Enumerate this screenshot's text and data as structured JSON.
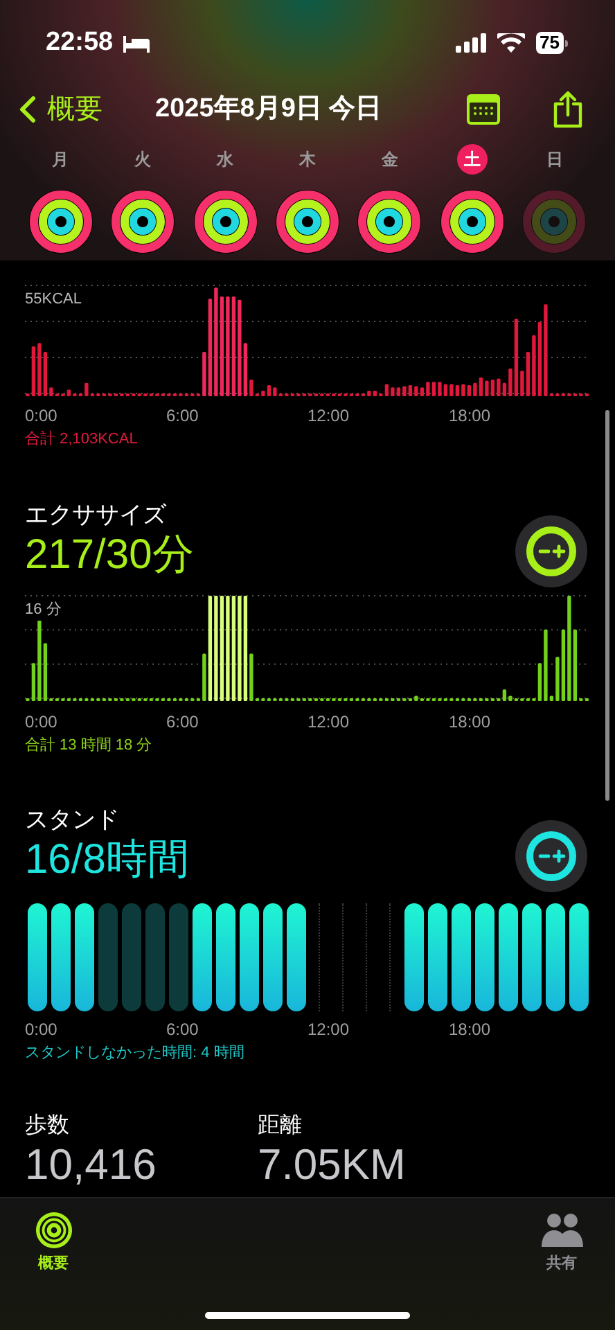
{
  "status_bar": {
    "time": "22:58",
    "battery": "75"
  },
  "nav": {
    "back": "概要",
    "title": "2025年8月9日 今日"
  },
  "week": [
    {
      "day": "月",
      "selected": false,
      "future": false
    },
    {
      "day": "火",
      "selected": false,
      "future": false
    },
    {
      "day": "水",
      "selected": false,
      "future": false
    },
    {
      "day": "木",
      "selected": false,
      "future": false
    },
    {
      "day": "金",
      "selected": false,
      "future": false
    },
    {
      "day": "土",
      "selected": true,
      "future": false
    },
    {
      "day": "日",
      "selected": false,
      "future": true
    }
  ],
  "move": {
    "y_label": "55KCAL",
    "x_labels": [
      "0:00",
      "6:00",
      "12:00",
      "18:00"
    ],
    "total": "合計 2,103KCAL"
  },
  "exercise": {
    "title": "エクササイズ",
    "value": "217/30分",
    "y_label": "16 分",
    "x_labels": [
      "0:00",
      "6:00",
      "12:00",
      "18:00"
    ],
    "total": "合計 13 時間 18 分"
  },
  "stand": {
    "title": "スタンド",
    "value": "16/8時間",
    "x_labels": [
      "0:00",
      "6:00",
      "12:00",
      "18:00"
    ],
    "note": "スタンドしなかった時間: 4 時間",
    "hours": [
      {
        "kind": "stood"
      },
      {
        "kind": "stood"
      },
      {
        "kind": "stood"
      },
      {
        "kind": "missed"
      },
      {
        "kind": "missed"
      },
      {
        "kind": "missed"
      },
      {
        "kind": "missed"
      },
      {
        "kind": "stood"
      },
      {
        "kind": "stood"
      },
      {
        "kind": "stood"
      },
      {
        "kind": "stood"
      },
      {
        "kind": "stood"
      },
      {
        "kind": "empty"
      },
      {
        "kind": "empty"
      },
      {
        "kind": "empty"
      },
      {
        "kind": "empty"
      },
      {
        "kind": "stood"
      },
      {
        "kind": "stood"
      },
      {
        "kind": "stood"
      },
      {
        "kind": "stood"
      },
      {
        "kind": "stood"
      },
      {
        "kind": "stood"
      },
      {
        "kind": "stood"
      },
      {
        "kind": "stood"
      }
    ]
  },
  "stats": [
    {
      "label": "歩数",
      "value": "10,416"
    },
    {
      "label": "距離",
      "value": "7.05KM"
    }
  ],
  "tabs": [
    {
      "label": "概要",
      "selected": true
    },
    {
      "label": "共有",
      "selected": false
    }
  ]
}
